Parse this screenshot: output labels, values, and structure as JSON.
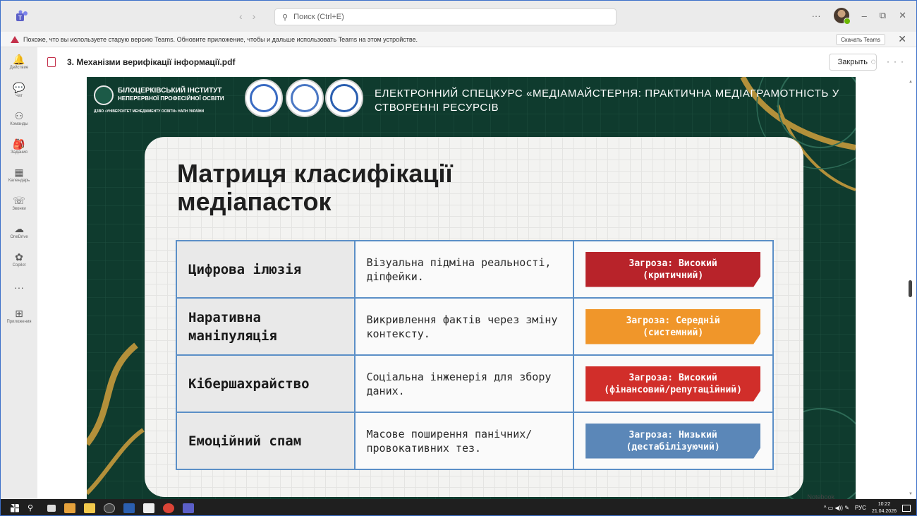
{
  "titlebar": {
    "search_placeholder": "Поиск (Ctrl+E)",
    "more": "···",
    "minimize": "–",
    "restore": "⧉",
    "close": "✕"
  },
  "warning": {
    "text": "Похоже, что вы используете старую версию Teams. Обновите приложение, чтобы и дальше использовать Teams на этом устройстве.",
    "button": "Скачать Teams",
    "close": "✕"
  },
  "rail": {
    "items": [
      {
        "label": "Действие",
        "icon": "bell-icon",
        "glyph": "🔔"
      },
      {
        "label": "Чат",
        "icon": "chat-icon",
        "glyph": "💬"
      },
      {
        "label": "Команды",
        "icon": "teams-icon",
        "glyph": "⚇"
      },
      {
        "label": "Задания",
        "icon": "assignments-icon",
        "glyph": "🎒"
      },
      {
        "label": "Календарь",
        "icon": "calendar-icon",
        "glyph": "▦"
      },
      {
        "label": "Звонки",
        "icon": "phone-icon",
        "glyph": "☏"
      },
      {
        "label": "OneDrive",
        "icon": "cloud-icon",
        "glyph": "☁"
      },
      {
        "label": "Copilot",
        "icon": "copilot-icon",
        "glyph": "✿"
      },
      {
        "label": "",
        "icon": "more-icon",
        "glyph": "···"
      },
      {
        "label": "Приложения",
        "icon": "apps-icon",
        "glyph": "⊞"
      }
    ]
  },
  "doc": {
    "title": "3. Механізми верифікації інформації.pdf",
    "close_button": "Закрыть",
    "icons": "◌ ···"
  },
  "slide": {
    "institute_line1": "БІЛОЦЕРКІВСЬКИЙ ІНСТИТУТ",
    "institute_line2": "НЕПЕРЕРВНОЇ ПРОФЕСІЙНОЇ ОСВІТИ",
    "institute_sub": "ДЗВО «УНІВЕРСИТЕТ МЕНЕДЖМЕНТУ ОСВІТИ» НАПН УКРАЇНИ",
    "course_title": "ЕЛЕКТРОННИЙ СПЕЦКУРС «МЕДІАМАЙСТЕРНЯ: ПРАКТИЧНА МЕДІАГРАМОТНІСТЬ У СТВОРЕННІ РЕСУРСІВ",
    "heading": "Матриця класифікації медіапасток",
    "watermark": "Notebook",
    "rows": [
      {
        "name": "Цифрова ілюзія",
        "description": "Візуальна підміна реальності, діпфейки.",
        "threat_line1": "Загроза: Високий",
        "threat_line2": "(критичний)",
        "color": "#b8232a"
      },
      {
        "name": "Наративна маніпуляція",
        "description": "Викривлення фактів через зміну контексту.",
        "threat_line1": "Загроза: Середній",
        "threat_line2": "(системний)",
        "color": "#f0962a"
      },
      {
        "name": "Кібершахрайство",
        "description": "Соціальна інженерія для збору даних.",
        "threat_line1": "Загроза: Високий",
        "threat_line2": "(фінансовий/репутаційний)",
        "color": "#d12e2a"
      },
      {
        "name": "Емоційний спам",
        "description": "Масове поширення панічних/провокативних тез.",
        "threat_line1": "Загроза: Низький",
        "threat_line2": "(дестабілізуючий)",
        "color": "#5b87b8"
      }
    ]
  },
  "taskbar": {
    "lang": "РУС",
    "time": "10:22",
    "date": "21.04.2026"
  }
}
